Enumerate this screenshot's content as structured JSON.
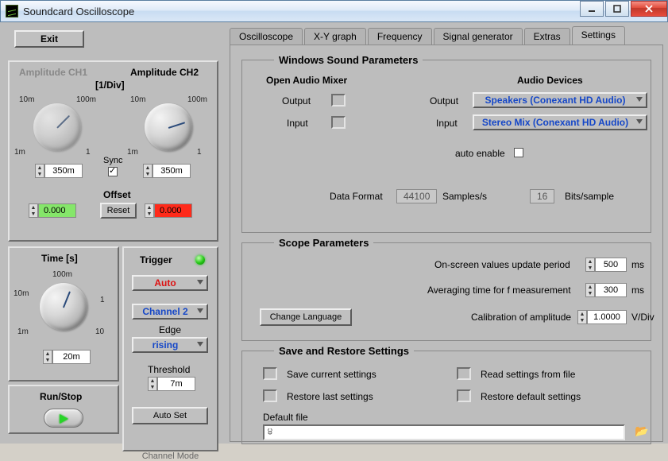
{
  "window": {
    "title": "Soundcard Oscilloscope",
    "min_icon": "minimize",
    "max_icon": "maximize",
    "close_icon": "close"
  },
  "toolbar": {
    "exit": "Exit"
  },
  "amplitude": {
    "heading_ch1": "Amplitude CH1",
    "heading_ch2": "Amplitude CH2",
    "units": "[1/Div]",
    "ticks": {
      "tl": "10m",
      "tr": "100m",
      "bl": "1m",
      "br": "1"
    },
    "ch1_value": "350m",
    "ch2_value": "350m",
    "sync_label": "Sync",
    "sync_checked": true,
    "offset_label": "Offset",
    "offset_ch1": "0.000",
    "offset_ch2": "0.000",
    "reset": "Reset"
  },
  "time": {
    "heading": "Time [s]",
    "ticks": {
      "top": "100m",
      "left": "10m",
      "right": "1",
      "bl": "1m",
      "br": "10"
    },
    "value": "20m"
  },
  "trigger": {
    "heading": "Trigger",
    "mode": "Auto",
    "channel": "Channel 2",
    "edge_label": "Edge",
    "edge": "rising",
    "threshold_label": "Threshold",
    "threshold": "7m",
    "autoset": "Auto Set"
  },
  "runstop": {
    "heading": "Run/Stop"
  },
  "channel_mode_label": "Channel Mode",
  "tabs": [
    "Oscilloscope",
    "X-Y graph",
    "Frequency",
    "Signal generator",
    "Extras",
    "Settings"
  ],
  "active_tab": "Settings",
  "settings": {
    "group_sound": "Windows Sound Parameters",
    "open_mixer": "Open Audio Mixer",
    "output_label": "Output",
    "input_label": "Input",
    "devices_label": "Audio Devices",
    "output_device": "Speakers (Conexant HD Audio)",
    "input_device": "Stereo Mix (Conexant HD Audio)",
    "auto_enable": "auto enable",
    "data_format": "Data Format",
    "sample_rate": "44100",
    "samples_s": "Samples/s",
    "bits": "16",
    "bits_sample": "Bits/sample",
    "group_scope": "Scope Parameters",
    "update_period_label": "On-screen values update period",
    "update_period": "500",
    "avg_time_label": "Averaging time for f measurement",
    "avg_time": "300",
    "ms": "ms",
    "cal_label": "Calibration of amplitude",
    "cal_value": "1.0000",
    "vdiv": "V/Div",
    "change_lang": "Change Language",
    "group_save": "Save and Restore Settings",
    "save_current": "Save current settings",
    "restore_last": "Restore last settings",
    "read_file": "Read settings from file",
    "restore_default": "Restore default settings",
    "default_file_label": "Default file",
    "default_file_value": "੪"
  }
}
